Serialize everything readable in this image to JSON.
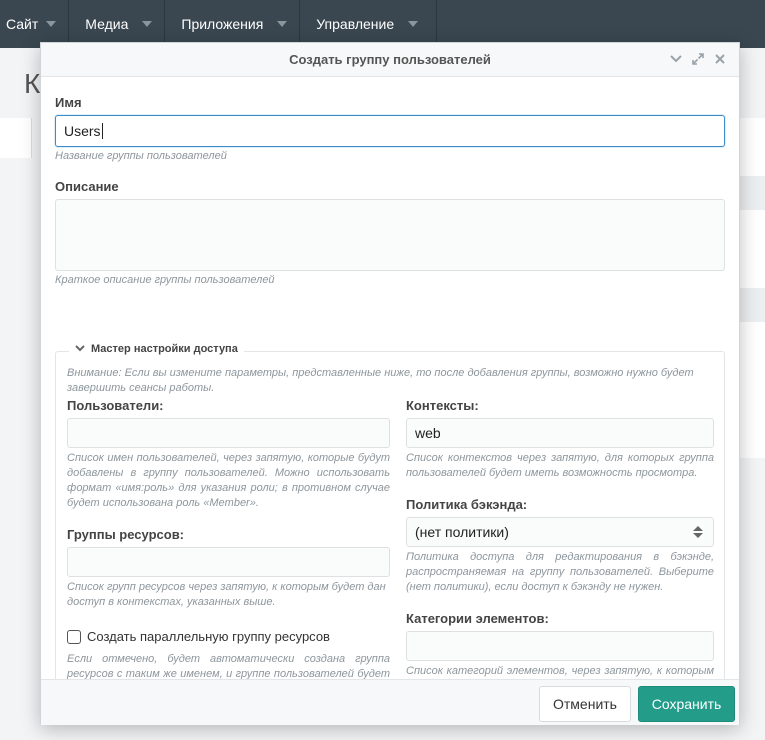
{
  "topnav": {
    "items": [
      {
        "label": "Сайт"
      },
      {
        "label": "Медиа"
      },
      {
        "label": "Приложения"
      },
      {
        "label": "Управление"
      }
    ]
  },
  "background": {
    "title_fragment": "К"
  },
  "modal": {
    "title": "Создать группу пользователей",
    "name": {
      "label": "Имя",
      "value": "Users",
      "hint": "Название группы пользователей"
    },
    "description": {
      "label": "Описание",
      "value": "",
      "hint": "Краткое описание группы пользователей"
    },
    "wizard": {
      "legend": "Мастер настройки доступа",
      "notice": "Внимание: Если вы измените параметры, представленные ниже, то после добавления группы, возможно нужно будет завершить сеансы работы.",
      "users": {
        "label": "Пользователи:",
        "value": "",
        "hint": "Список имен пользователей, через запятую, которые будут добавлены в группу пользователей. Можно использовать формат «имя:роль» для указания роли; в противном случае будет использована роль «Member»."
      },
      "resource_groups": {
        "label": "Группы ресурсов:",
        "value": "",
        "hint": "Список групп ресурсов через запятую, к которым будет дан доступ в контекстах, указанных выше."
      },
      "parallel_group": {
        "label": "Создать параллельную группу ресурсов",
        "checked": false,
        "hint": "Если отмечено, будет автоматически создана группа ресурсов с таким же именем, и группе пользователей будет дан доступ к просмотру в контекстах, указанных выше."
      },
      "contexts": {
        "label": "Контексты:",
        "value": "web",
        "hint": "Список контекстов через запятую, для которых группа пользователей будет иметь возможность просмотра."
      },
      "backend_policy": {
        "label": "Политика бэкэнда:",
        "selected": "(нет политики)",
        "hint": "Политика доступа для редактирования в бэкэнде, распространяемая на группу пользователей. Выберите (нет политики), если доступ к бэкэнду не нужен."
      },
      "element_categories": {
        "label": "Категории элементов:",
        "value": "",
        "hint": "Список категорий элементов, через запятую, к которым будет дан доступ в контекстах, указанных выше."
      }
    },
    "buttons": {
      "cancel": "Отменить",
      "save": "Сохранить"
    }
  },
  "colors": {
    "topbar": "#3a4750",
    "accent_focus": "#3d8cc7",
    "save_button": "#239d8a"
  }
}
